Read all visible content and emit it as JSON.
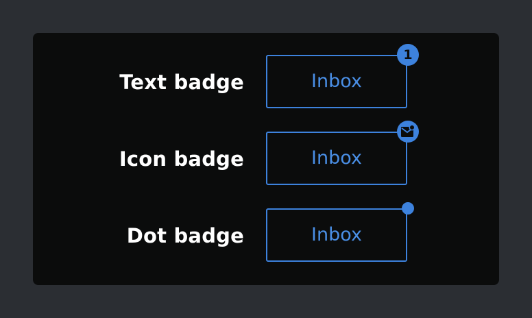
{
  "rows": [
    {
      "label": "Text badge",
      "button_label": "Inbox",
      "badge_text": "1",
      "badge_type": "text"
    },
    {
      "label": "Icon badge",
      "button_label": "Inbox",
      "badge_icon": "mail-notification-icon",
      "badge_type": "icon"
    },
    {
      "label": "Dot badge",
      "button_label": "Inbox",
      "badge_type": "dot"
    }
  ],
  "colors": {
    "page_background": "#2b2e33",
    "panel_background": "#0b0c0c",
    "accent": "#3d82dd",
    "label_text": "#ffffff"
  }
}
